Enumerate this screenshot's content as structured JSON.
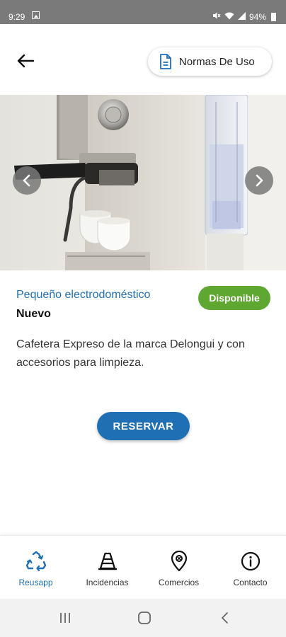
{
  "status_bar": {
    "time": "9:29",
    "battery": "94%",
    "icons": [
      "image-icon",
      "mute-icon",
      "wifi-icon",
      "signal-icon",
      "battery-icon"
    ]
  },
  "header": {
    "back_icon": "arrow-left-icon",
    "rules_button_label": "Normas De Uso",
    "rules_icon": "document-icon"
  },
  "carousel": {
    "prev_icon": "chevron-left-icon",
    "next_icon": "chevron-right-icon"
  },
  "item": {
    "category": "Pequeño electrodoméstico",
    "condition": "Nuevo",
    "status": "Disponible",
    "description": "Cafetera Expreso de la marca Delongui y con accesorios para limpieza."
  },
  "actions": {
    "reserve_label": "RESERVAR"
  },
  "bottom_nav": {
    "items": [
      {
        "label": "Reusapp",
        "icon": "recycle-icon",
        "active": true
      },
      {
        "label": "Incidencias",
        "icon": "traffic-cone-icon",
        "active": false
      },
      {
        "label": "Comercios",
        "icon": "map-pin-icon",
        "active": false
      },
      {
        "label": "Contacto",
        "icon": "info-icon",
        "active": false
      }
    ]
  },
  "system_nav": {
    "icons": [
      "recents-icon",
      "home-icon",
      "back-icon"
    ]
  },
  "colors": {
    "accent": "#1f6fb5",
    "badge": "#5ea832",
    "status_bar": "#7a7a7a"
  }
}
